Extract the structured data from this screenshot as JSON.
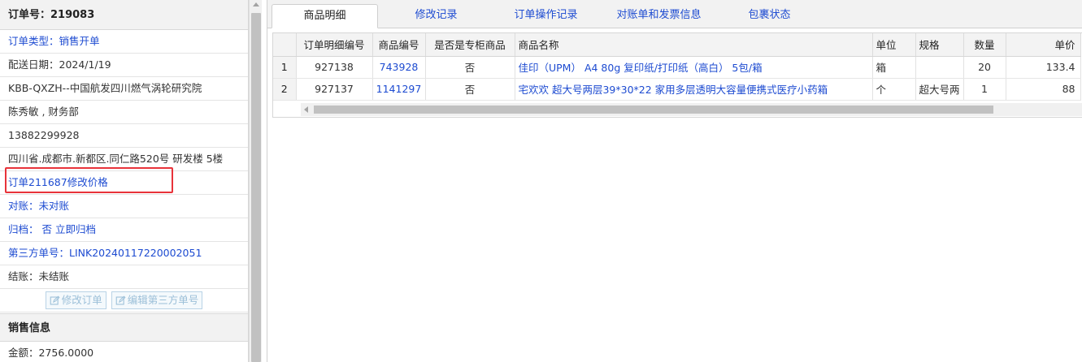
{
  "order": {
    "header": "订单号：219083",
    "type": "订单类型：销售开单",
    "delivery_date": "配送日期：2024/1/19",
    "customer": "KBB-QXZH--中国航发四川燃气涡轮研究院",
    "contact": "陈秀敏 , 财务部",
    "phone": "13882299928",
    "address": "四川省.成都市.新都区.同仁路520号 研发楼 5楼",
    "price_change": "订单211687修改价格",
    "reconcile": "对账：未对账",
    "archive": "归档： 否 立即归档",
    "third_party_no": "第三方单号：LINK20240117220002051",
    "settlement": "结账：未结账",
    "edit_order_label": "修改订单",
    "edit_third_party_label": "编辑第三方单号"
  },
  "sales": {
    "header": "销售信息",
    "amount": "金额：2756.0000"
  },
  "tabs": [
    {
      "label": "商品明细",
      "active": true
    },
    {
      "label": "修改记录",
      "active": false
    },
    {
      "label": "订单操作记录",
      "active": false
    },
    {
      "label": "对账单和发票信息",
      "active": false
    },
    {
      "label": "包裹状态",
      "active": false
    }
  ],
  "grid": {
    "columns": [
      "订单明细编号",
      "商品编号",
      "是否是专柜商品",
      "商品名称",
      "单位",
      "规格",
      "数量",
      "单价"
    ],
    "rows": [
      {
        "n": "1",
        "detail_id": "927138",
        "product_id": "743928",
        "is_counter": "否",
        "name": "佳印（UPM） A4 80g 复印纸/打印纸（高白） 5包/箱",
        "unit": "箱",
        "spec": "",
        "qty": "20",
        "price": "133.4"
      },
      {
        "n": "2",
        "detail_id": "927137",
        "product_id": "1141297",
        "is_counter": "否",
        "name": "宅欢欢 超大号两层39*30*22 家用多层透明大容量便携式医疗小药箱",
        "unit": "个",
        "spec": "超大号两",
        "qty": "1",
        "price": "88"
      }
    ]
  },
  "icons": [
    "edit-icon",
    "scroll-up-arrow-icon",
    "scroll-left-arrow-icon"
  ],
  "colors": {
    "link": "#1d4bd1",
    "highlight": "#e8333a"
  }
}
